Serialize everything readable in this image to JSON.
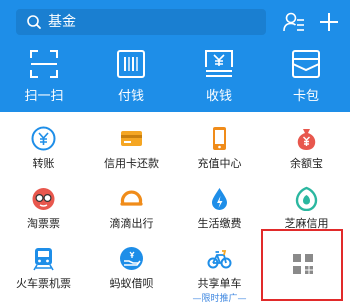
{
  "search": {
    "text": "基金",
    "icon": "search-icon"
  },
  "header_icons": {
    "contacts": "contacts-icon",
    "add": "plus-icon"
  },
  "top_actions": [
    {
      "label": "扫一扫",
      "icon": "scan-icon"
    },
    {
      "label": "付钱",
      "icon": "barcode-pay-icon"
    },
    {
      "label": "收钱",
      "icon": "yen-receive-icon"
    },
    {
      "label": "卡包",
      "icon": "card-wallet-icon"
    }
  ],
  "services": [
    {
      "label": "转账",
      "icon": "transfer-icon"
    },
    {
      "label": "信用卡还款",
      "icon": "credit-card-icon"
    },
    {
      "label": "充值中心",
      "icon": "phone-topup-icon"
    },
    {
      "label": "余额宝",
      "icon": "money-bag-icon"
    },
    {
      "label": "淘票票",
      "icon": "movie-ticket-icon"
    },
    {
      "label": "滴滴出行",
      "icon": "didi-icon"
    },
    {
      "label": "生活缴费",
      "icon": "utility-drop-icon"
    },
    {
      "label": "芝麻信用",
      "icon": "sesame-credit-icon"
    },
    {
      "label": "火车票机票",
      "icon": "train-icon"
    },
    {
      "label": "蚂蚁借呗",
      "icon": "borrow-hand-icon"
    },
    {
      "label": "共享单车",
      "icon": "bicycle-icon",
      "sub": "—限时推广—"
    },
    {
      "label": "",
      "icon": "more-grid-icon"
    }
  ],
  "colors": {
    "header": "#1e8ee8",
    "highlight_box": "#e12a2a",
    "promo_text": "#3c86e0"
  }
}
